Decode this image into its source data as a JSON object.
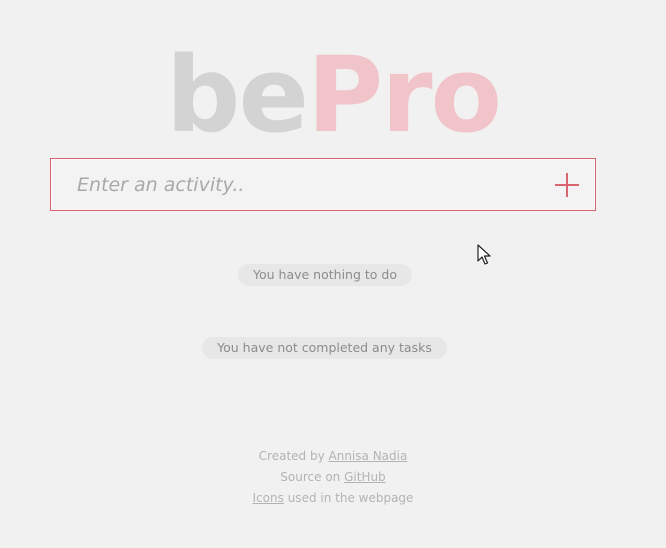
{
  "logo": {
    "part1": "be",
    "part2": "Pro"
  },
  "entry": {
    "placeholder": "Enter an activity..",
    "value": ""
  },
  "add_button": {
    "icon": "plus-icon"
  },
  "status": {
    "todo_empty": "You have nothing to do",
    "completed_empty": "You have not completed any tasks"
  },
  "footer": {
    "line1_prefix": "Created by ",
    "line1_link": "Annisa Nadia",
    "line2_prefix": "Source on ",
    "line2_link": "GitHub",
    "line3_link": "Icons",
    "line3_suffix": " used in the webpage"
  },
  "colors": {
    "accent": "#d9646f",
    "logo_gray": "#d4d3d3",
    "logo_pink": "#f0c4c8",
    "background": "#f2f1f1"
  }
}
